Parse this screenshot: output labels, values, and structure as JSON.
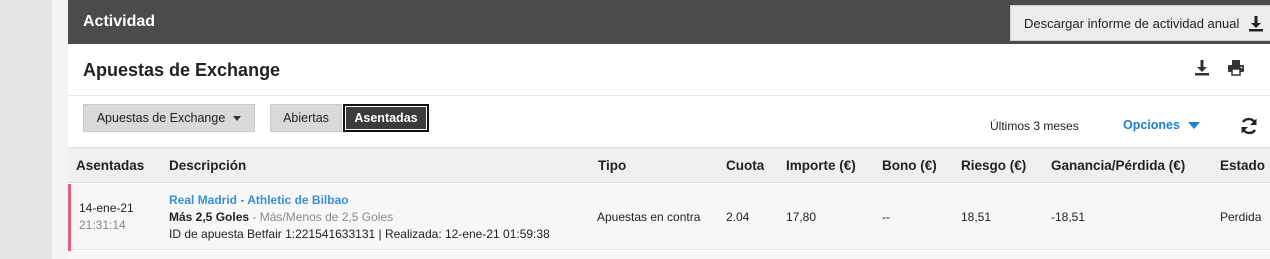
{
  "header": {
    "title": "Actividad",
    "download_annual_label": "Descargar informe de actividad anual"
  },
  "section": {
    "title": "Apuestas de Exchange"
  },
  "filters": {
    "dropdown_label": "Apuestas de Exchange",
    "open_label": "Abiertas",
    "settled_label": "Asentadas",
    "period_label": "Últimos 3 meses",
    "options_label": "Opciones"
  },
  "table": {
    "headers": {
      "settled": "Asentadas",
      "description": "Descripción",
      "type": "Tipo",
      "odds": "Cuota",
      "amount": "Importe (€)",
      "bonus": "Bono (€)",
      "risk": "Riesgo (€)",
      "profit_loss": "Ganancia/Pérdida (€)",
      "status": "Estado"
    },
    "rows": [
      {
        "date": "14-ene-21",
        "time": "21:31:14",
        "match": "Real Madrid - Athletic de Bilbao",
        "selection": "Más 2,5 Goles",
        "separator": " - ",
        "market": "Más/Menos de 2,5 Goles",
        "details": "ID de apuesta Betfair 1:221541633131 | Realizada: 12-ene-21 01:59:38",
        "type": "Apuestas en contra",
        "odds": "2.04",
        "amount": "17,80",
        "bonus": "--",
        "risk": "18,51",
        "profit_loss": "-18,51",
        "status": "Perdida"
      }
    ]
  },
  "colors": {
    "header_bg": "#4b4b4b",
    "link_blue": "#1f7fd1",
    "lost_marker": "#e85a7a"
  }
}
